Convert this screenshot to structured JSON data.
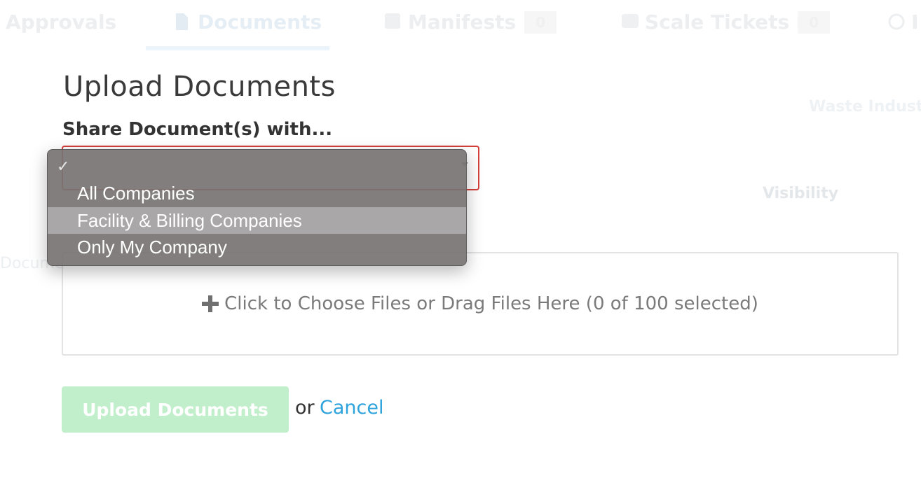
{
  "tabs": [
    {
      "label": "Approvals",
      "icon": "",
      "count": ""
    },
    {
      "label": "Documents",
      "icon": "document-icon",
      "count": ""
    },
    {
      "label": "Manifests",
      "icon": "check-icon",
      "count": "0"
    },
    {
      "label": "Scale Tickets",
      "icon": "scale-icon",
      "count": "0"
    },
    {
      "label": "I",
      "icon": "history-icon",
      "count": ""
    }
  ],
  "background": {
    "company_text": "Waste Industr",
    "visibility_header": "Visibility",
    "docs_text": "Documents for this Waste Stream."
  },
  "form": {
    "title": "Upload Documents",
    "share_label": "Share Document(s) with...",
    "select_value": ""
  },
  "dropdown": {
    "check_mark": "✓",
    "options": [
      {
        "label": "",
        "selected": true
      },
      {
        "label": "All Companies",
        "selected": false
      },
      {
        "label": "Facility & Billing Companies",
        "selected": false,
        "highlighted": true
      },
      {
        "label": "Only My Company",
        "selected": false
      }
    ]
  },
  "dropzone": {
    "text": "Click to Choose Files or Drag Files Here (0 of 100 selected)"
  },
  "actions": {
    "upload_label": "Upload Documents",
    "or_text": "or",
    "cancel_label": "Cancel"
  },
  "colors": {
    "error_border": "#d43f3a",
    "upload_button_disabled": "#c2efcb",
    "link": "#2ea3dc",
    "menu_bg": "#787474",
    "menu_highlight": "#a9a7a7"
  }
}
